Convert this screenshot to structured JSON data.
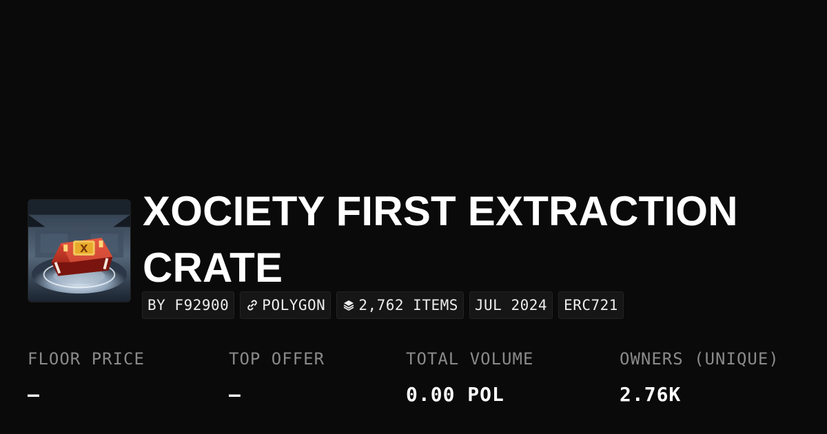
{
  "collection": {
    "title": "XOCIETY FIRST EXTRACTION CRATE",
    "thumbnail_icon": "crate-icon"
  },
  "tags": {
    "creator": "BY F92900",
    "chain": "POLYGON",
    "chain_icon": "link-icon",
    "items": "2,762 ITEMS",
    "items_icon": "layers-icon",
    "date": "JUL 2024",
    "standard": "ERC721"
  },
  "stats": {
    "floor_price": {
      "label": "FLOOR PRICE",
      "value": "—"
    },
    "top_offer": {
      "label": "TOP OFFER",
      "value": "—"
    },
    "total_volume": {
      "label": "TOTAL VOLUME",
      "value": "0.00 POL"
    },
    "owners": {
      "label": "OWNERS (UNIQUE)",
      "value": "2.76K"
    }
  },
  "colors": {
    "background": "#0a0a0a",
    "text_primary": "#ffffff",
    "text_muted": "#8a8a8a",
    "chip_background": "#161616",
    "crate_red": "#c8281c",
    "crate_gold": "#e8a92c"
  }
}
